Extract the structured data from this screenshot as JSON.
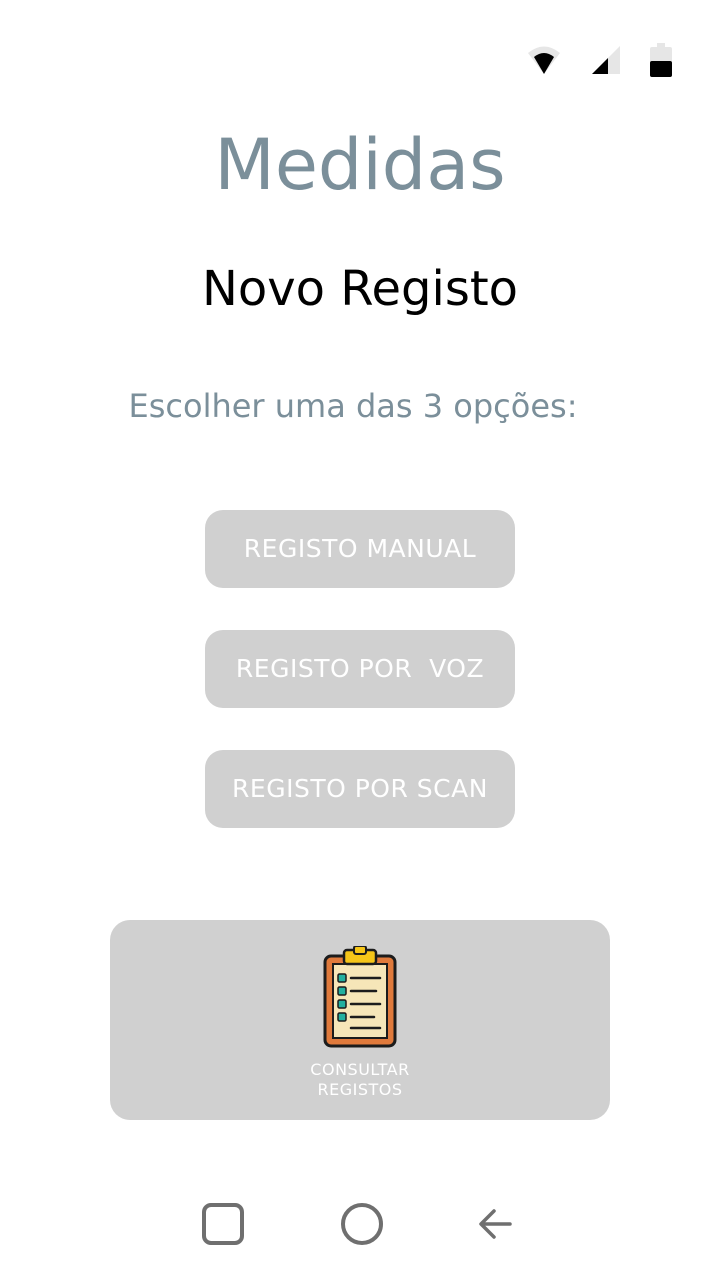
{
  "status_bar": {
    "icons": [
      "wifi-icon",
      "signal-icon",
      "battery-icon"
    ]
  },
  "header": {
    "app_title": "Medidas",
    "screen_title": "Novo Registo",
    "instructions": "Escolher uma das 3 opções:"
  },
  "options": {
    "manual_label": "REGISTO MANUAL",
    "voz_label": "REGISTO POR  VOZ",
    "scan_label": "REGISTO POR SCAN"
  },
  "consult": {
    "icon": "clipboard-icon",
    "label_line1": "CONSULTAR",
    "label_line2": "REGISTOS"
  },
  "nav_bar": {
    "icons": [
      "recents-icon",
      "home-icon",
      "back-icon"
    ]
  },
  "colors": {
    "title": "#7b8f9a",
    "button_bg": "#d0d0d0",
    "button_text": "#ffffff",
    "text_dark": "#000000"
  }
}
